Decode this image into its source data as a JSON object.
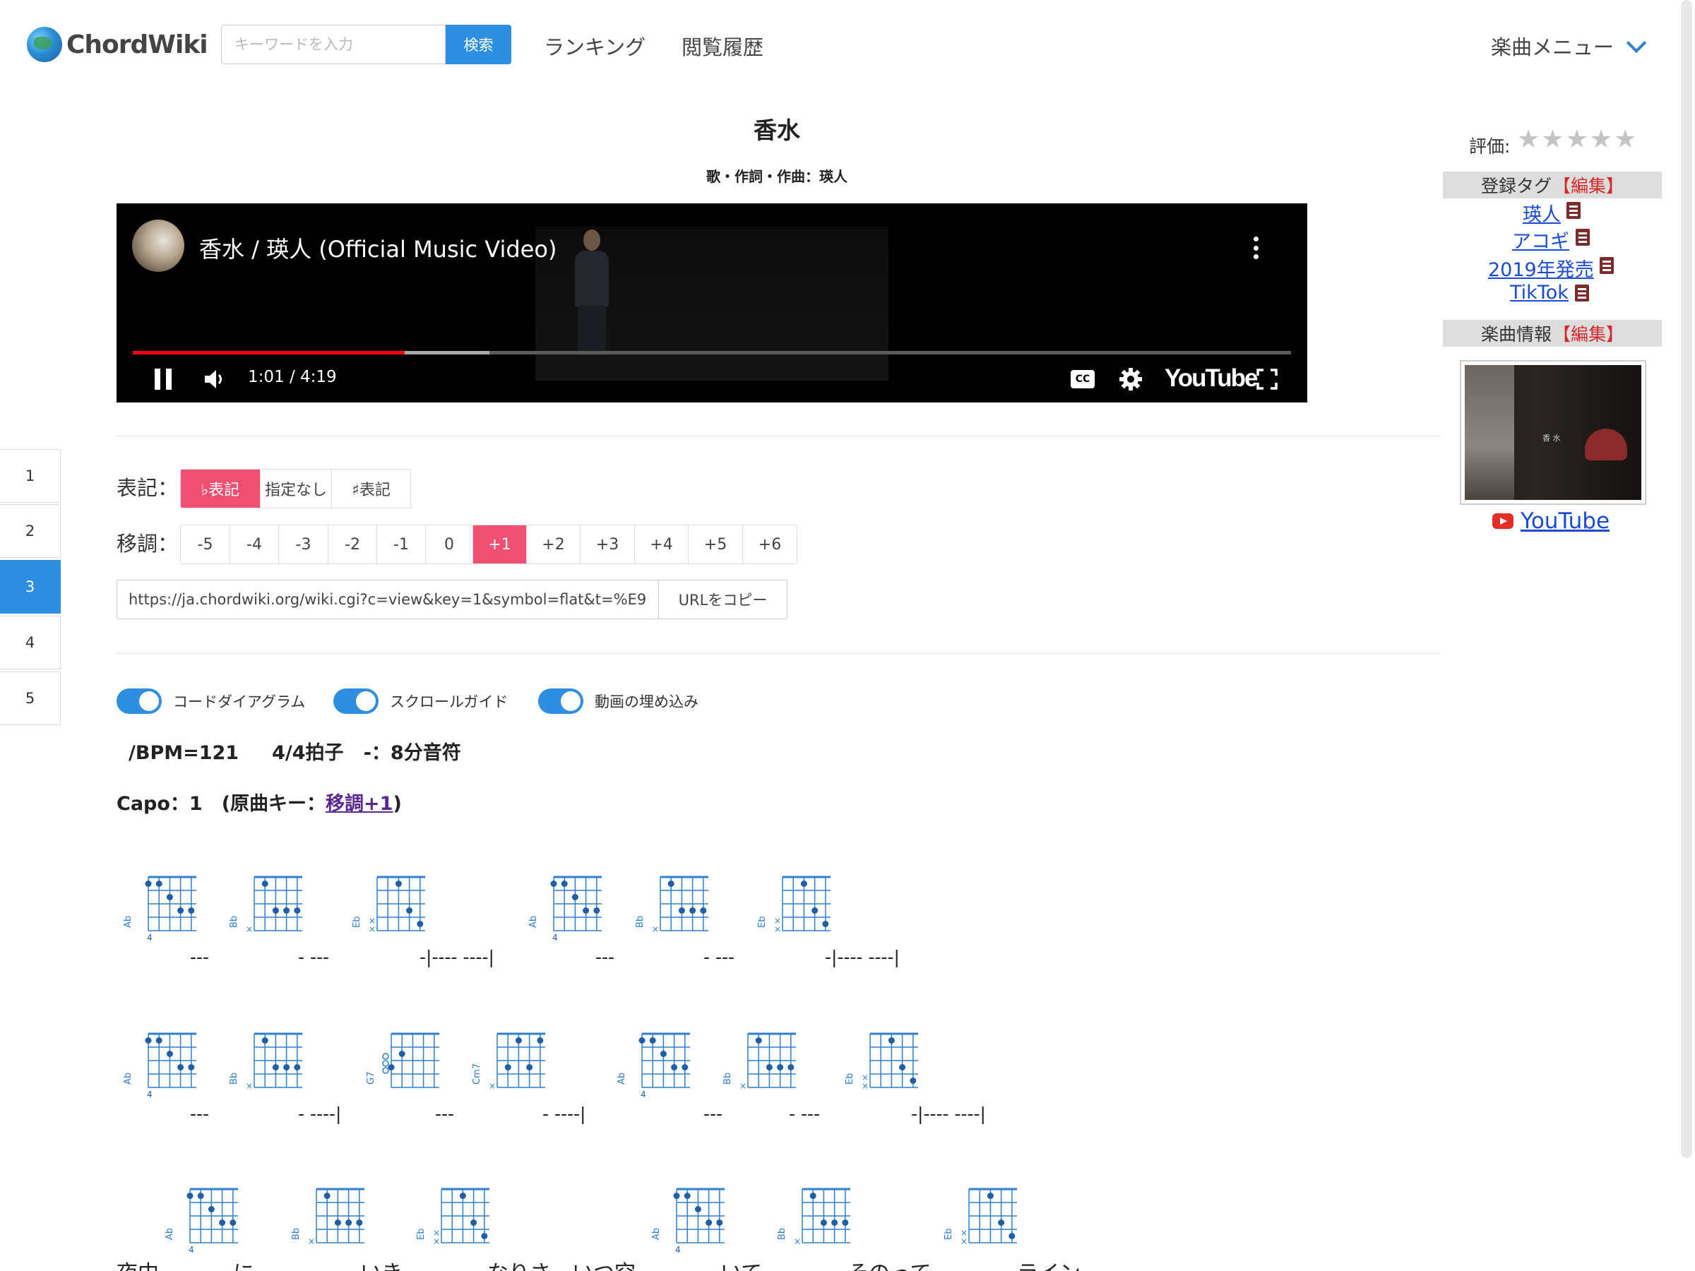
{
  "header": {
    "logo_text": "ChordWiki",
    "search_placeholder": "キーワードを入力",
    "search_button": "検索",
    "nav": [
      "ランキング",
      "閲覧履歴"
    ],
    "menu_label": "楽曲メニュー"
  },
  "song": {
    "title": "香水",
    "credit": "歌・作詞・作曲：瑛人"
  },
  "video": {
    "title": "香水 / 瑛人 (Official Music Video)",
    "time": "1:01 / 4:19",
    "played_fraction": 0.235,
    "buffered_fraction": 0.308,
    "brand": "YouTube",
    "cc_label": "CC"
  },
  "side_tabs": [
    "1",
    "2",
    "3",
    "4",
    "5"
  ],
  "side_tab_active": "3",
  "notation": {
    "label": "表記：",
    "options": [
      "♭表記",
      "指定なし",
      "♯表記"
    ],
    "selected": "♭表記"
  },
  "transpose": {
    "label": "移調：",
    "options": [
      "-5",
      "-4",
      "-3",
      "-2",
      "-1",
      "0",
      "+1",
      "+2",
      "+3",
      "+4",
      "+5",
      "+6"
    ],
    "selected": "+1"
  },
  "share": {
    "url": "https://ja.chordwiki.org/wiki.cgi?c=view&key=1&symbol=flat&t=%E9%",
    "copy_button": "URLをコピー"
  },
  "toggles": [
    {
      "label": "コードダイアグラム",
      "on": true
    },
    {
      "label": "スクロールガイド",
      "on": true
    },
    {
      "label": "動画の埋め込み",
      "on": true
    }
  ],
  "song_info": {
    "bpm_line": "/BPM=121     4/4拍子   -：8分音符",
    "capo_text": "Capo：1　(原曲キー：",
    "capo_link": "移調+1",
    "capo_close": ")"
  },
  "chord_rows": [
    {
      "chords": [
        "Ab",
        "Bb",
        "Eb",
        "Ab",
        "Bb",
        "Eb"
      ],
      "bars": [
        "---",
        "- ---",
        "-|---- ----|",
        "---",
        "- ---",
        "-|---- ----|"
      ]
    },
    {
      "chords": [
        "Ab",
        "Bb",
        "G7",
        "Cm7",
        "Ab",
        "Bb",
        "Eb"
      ],
      "bars": [
        "---",
        "- ----|",
        "---",
        "- ----|",
        "---",
        "- ---",
        "-|---- ----|"
      ]
    },
    {
      "chords": [
        "Ab",
        "Bb",
        "Eb",
        "Ab",
        "Bb",
        "Eb"
      ],
      "lyrics": [
        "夜中",
        "に",
        "いき",
        "なりさ",
        "いつ空",
        "いて",
        "そのって",
        "ライン"
      ]
    }
  ],
  "fret_marker": "4",
  "sidebar": {
    "rating_label": "評価:",
    "rating_value": 0,
    "rating_max": 5,
    "tags_header": "登録タグ",
    "edit_label": "【編集】",
    "tags": [
      "瑛人",
      "アコギ",
      "2019年発売",
      "TikTok"
    ],
    "info_header": "楽曲情報",
    "thumb_caption": "香 水",
    "youtube_link": "YouTube"
  }
}
